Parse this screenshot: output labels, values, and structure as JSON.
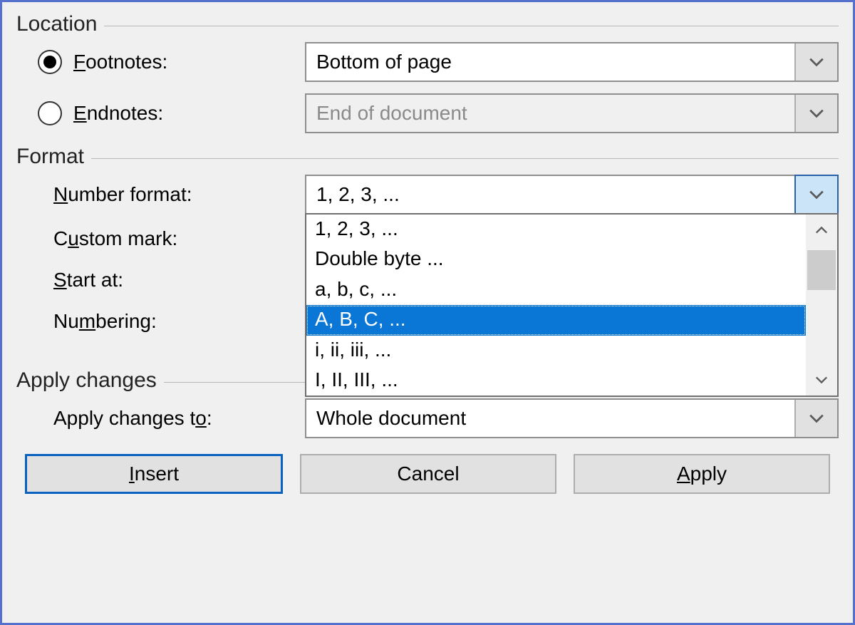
{
  "sections": {
    "location": {
      "title": "Location",
      "footnotes": {
        "label_pre": "",
        "label_ul": "F",
        "label_post": "ootnotes:",
        "value": "Bottom of page",
        "checked": true
      },
      "endnotes": {
        "label_pre": "",
        "label_ul": "E",
        "label_post": "ndnotes:",
        "value": "End of document",
        "checked": false
      }
    },
    "format": {
      "title": "Format",
      "number_format": {
        "label_pre": "",
        "label_ul": "N",
        "label_post": "umber format:",
        "value": "1, 2, 3, ...",
        "options": [
          "1, 2, 3, ...",
          "Double byte ...",
          "a, b, c, ...",
          "A, B, C, ...",
          "i, ii, iii, ...",
          "I, II, III, ..."
        ],
        "selected_index": 3
      },
      "custom_mark": {
        "label_pre": "C",
        "label_ul": "u",
        "label_post": "stom mark:"
      },
      "start_at": {
        "label_pre": "",
        "label_ul": "S",
        "label_post": "tart at:"
      },
      "numbering": {
        "label_pre": "Nu",
        "label_ul": "m",
        "label_post": "bering:"
      }
    },
    "apply": {
      "title": "Apply changes",
      "apply_to": {
        "label_pre": "Apply changes t",
        "label_ul": "o",
        "label_post": ":",
        "value": "Whole document"
      }
    }
  },
  "buttons": {
    "insert": {
      "pre": "",
      "ul": "I",
      "post": "nsert"
    },
    "cancel": {
      "pre": "Cancel",
      "ul": "",
      "post": ""
    },
    "apply": {
      "pre": "",
      "ul": "A",
      "post": "pply"
    }
  }
}
